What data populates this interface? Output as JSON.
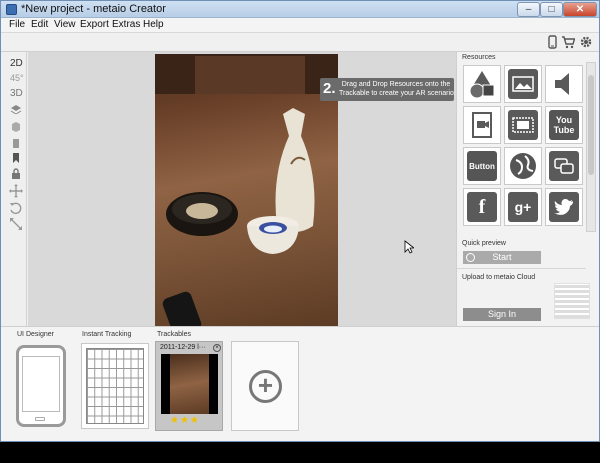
{
  "window": {
    "title": "*New project - metaio Creator",
    "controls": {
      "minimize": "–",
      "maximize": "□",
      "close": "✕"
    }
  },
  "menu": [
    "File",
    "Edit",
    "View",
    "Export",
    "Extras",
    "Help"
  ],
  "toolbar": {
    "icons": [
      "phone-icon",
      "cart-icon",
      "gear-icon"
    ]
  },
  "left_tools": {
    "view_2d": "2D",
    "view_45": "45°",
    "view_3d": "3D"
  },
  "canvas": {
    "hint_number": "2.",
    "hint_line1": "Drag and Drop Resources onto the",
    "hint_line2": "Trackable to create your AR scenario"
  },
  "resources": {
    "label": "Resources",
    "items": [
      {
        "name": "shapes",
        "label": ""
      },
      {
        "name": "image",
        "label": ""
      },
      {
        "name": "sound",
        "label": ""
      },
      {
        "name": "video",
        "label": ""
      },
      {
        "name": "movie",
        "label": ""
      },
      {
        "name": "youtube",
        "label": "You Tube"
      },
      {
        "name": "button",
        "label": "Button"
      },
      {
        "name": "web",
        "label": ""
      },
      {
        "name": "social",
        "label": ""
      },
      {
        "name": "facebook",
        "label": "f"
      },
      {
        "name": "googleplus",
        "label": "g+"
      },
      {
        "name": "twitter",
        "label": ""
      }
    ],
    "quick_preview_label": "Quick preview",
    "start_button": "Start",
    "upload_label": "Upload to metaio Cloud",
    "signin_button": "Sign In"
  },
  "bottom": {
    "ui_designer_label": "UI Designer",
    "instant_tracking_label": "Instant Tracking",
    "trackables_label": "Trackables",
    "trackable_title": "2011-12-29 l···",
    "trackable_rating": "★★★",
    "add_symbol": "+"
  }
}
